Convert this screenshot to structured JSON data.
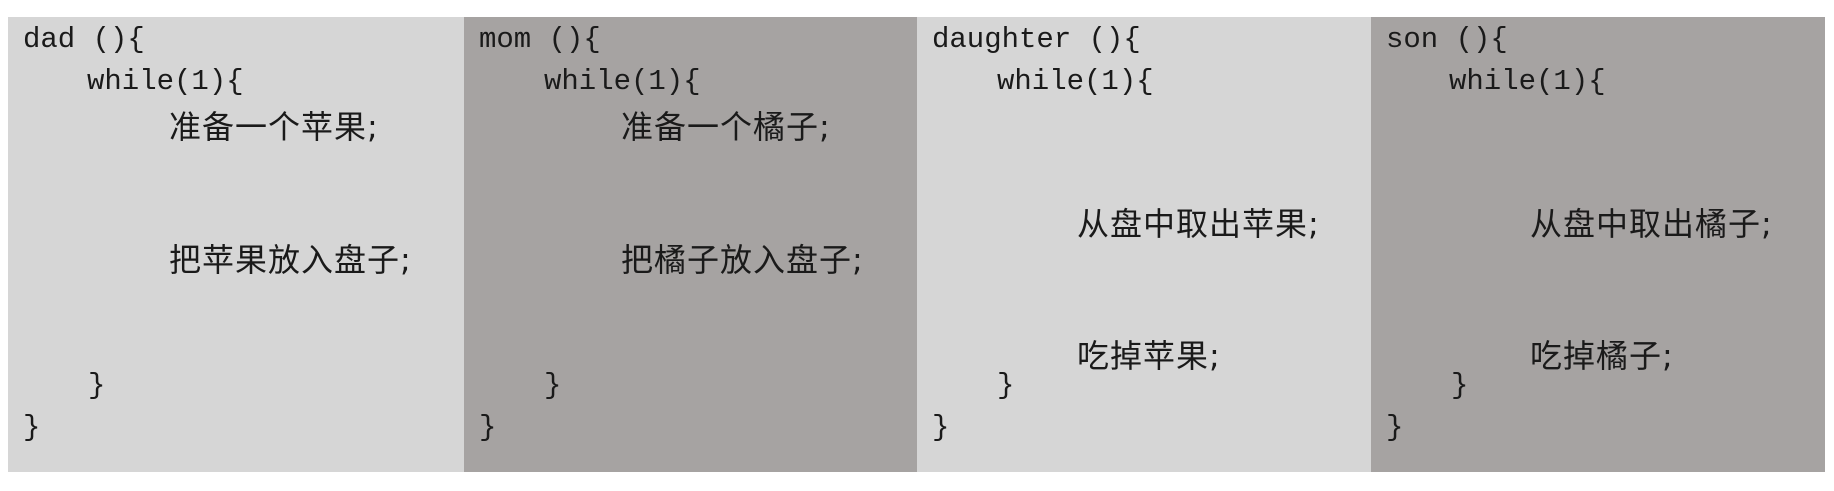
{
  "panels": [
    {
      "header": "dad (){",
      "loop": "while(1){",
      "stmts": [
        "准备一个苹果;",
        "把苹果放入盘子;"
      ],
      "inner_close": "}",
      "outer_close": "}",
      "bg": "#d6d6d6"
    },
    {
      "header": "mom (){",
      "loop": "while(1){",
      "stmts": [
        "准备一个橘子;",
        "把橘子放入盘子;"
      ],
      "inner_close": "}",
      "outer_close": "}",
      "bg": "#a6a3a2"
    },
    {
      "header": "daughter (){",
      "loop": "while(1){",
      "stmts": [
        "从盘中取出苹果;",
        "吃掉苹果;"
      ],
      "inner_close": "}",
      "outer_close": "}",
      "bg": "#d6d6d6"
    },
    {
      "header": "son (){",
      "loop": "while(1){",
      "stmts": [
        "从盘中取出橘子;",
        "吃掉橘子;"
      ],
      "inner_close": "}",
      "outer_close": "}",
      "bg": "#a6a3a2"
    }
  ]
}
